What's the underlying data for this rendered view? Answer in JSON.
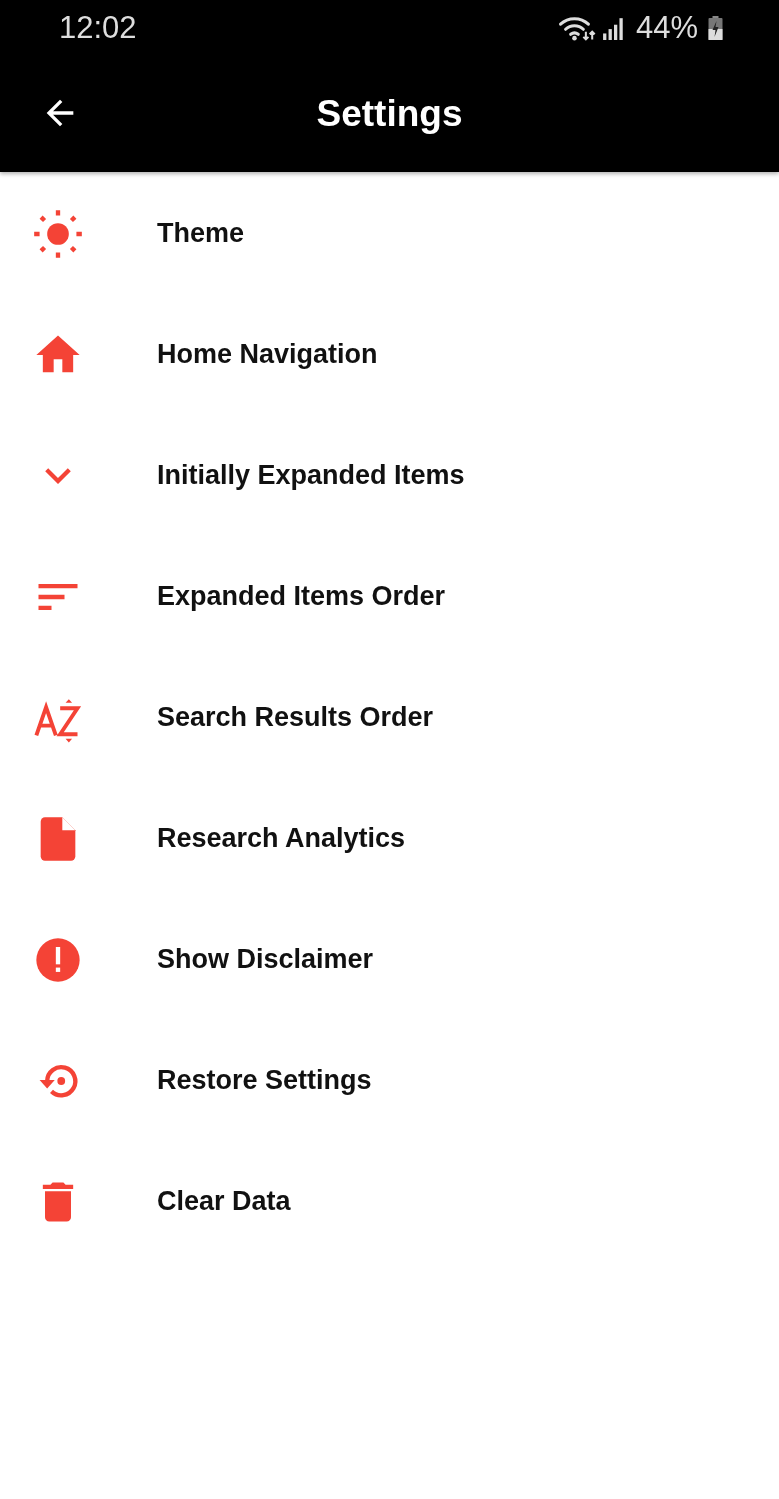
{
  "status_bar": {
    "time": "12:02",
    "battery": "44%"
  },
  "app_bar": {
    "title": "Settings"
  },
  "settings": [
    {
      "label": "Theme"
    },
    {
      "label": "Home Navigation"
    },
    {
      "label": "Initially Expanded Items"
    },
    {
      "label": "Expanded Items Order"
    },
    {
      "label": "Search Results Order"
    },
    {
      "label": "Research Analytics"
    },
    {
      "label": "Show Disclaimer"
    },
    {
      "label": "Restore Settings"
    },
    {
      "label": "Clear Data"
    }
  ]
}
